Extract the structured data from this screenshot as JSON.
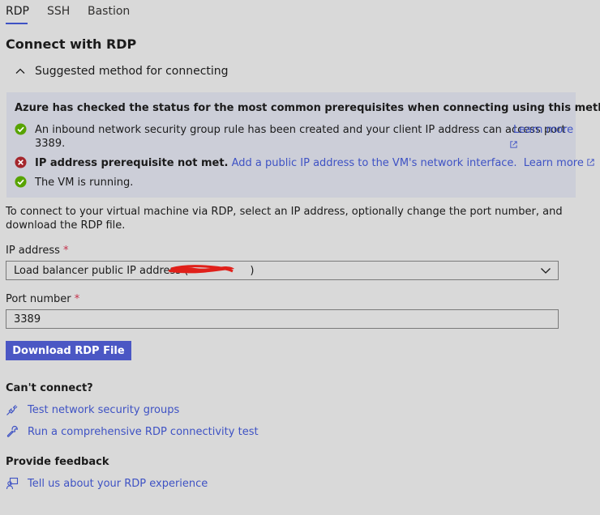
{
  "tabs": [
    {
      "label": "RDP",
      "active": true
    },
    {
      "label": "SSH",
      "active": false
    },
    {
      "label": "Bastion",
      "active": false
    }
  ],
  "page_title": "Connect with RDP",
  "suggested": {
    "label": "Suggested method for connecting",
    "expanded": true
  },
  "prereq": {
    "header": "Azure has checked the status for the most common prerequisites when connecting using this method.",
    "items": [
      {
        "status": "success",
        "text_line1": "An inbound network security group rule has been created and your client IP address can access port",
        "text_line2": "3389.",
        "link": "Learn more"
      },
      {
        "status": "error",
        "bold_text": "IP address prerequisite not met.",
        "action_link": "Add a public IP address to the VM's network interface.",
        "link": "Learn more"
      },
      {
        "status": "success",
        "text": "The VM is running."
      }
    ]
  },
  "instruction": "To connect to your virtual machine via RDP, select an IP address, optionally change the port number, and download the RDP file.",
  "ip_address": {
    "label": "IP address",
    "required_mark": "*",
    "selected_value": "Load balancer public IP address (",
    "value_suffix": ")"
  },
  "port": {
    "label": "Port number",
    "required_mark": "*",
    "value": "3389"
  },
  "download_button": "Download RDP File",
  "cant_connect": {
    "title": "Can't connect?",
    "links": [
      {
        "label": "Test network security groups",
        "icon": "plug-icon"
      },
      {
        "label": "Run a comprehensive RDP connectivity test",
        "icon": "wrench-icon"
      }
    ]
  },
  "feedback": {
    "title": "Provide feedback",
    "link": "Tell us about your RDP experience",
    "icon": "feedback-person-icon"
  },
  "colors": {
    "accent": "#3e52c4",
    "button": "#4b57c4",
    "success": "#57a300",
    "error": "#a4262c",
    "required": "#c4314b",
    "background": "#d9d9d9",
    "info_box": "#ccced8"
  }
}
